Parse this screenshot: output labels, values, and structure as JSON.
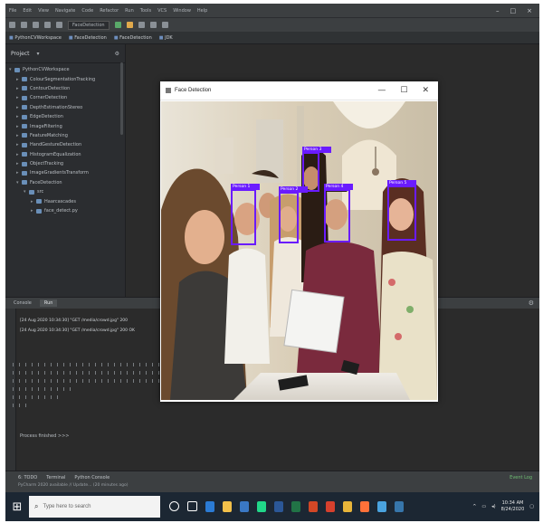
{
  "ide": {
    "menu": [
      "File",
      "Edit",
      "View",
      "Navigate",
      "Code",
      "Refactor",
      "Run",
      "Tools",
      "VCS",
      "Window",
      "Help"
    ],
    "toolbar": {
      "config_combo": "FaceDetection"
    },
    "breadcrumbs": [
      "PythonCVWorkspace",
      "FaceDetection",
      "FaceDetection",
      "JDK"
    ],
    "sidebar": {
      "title": "Project",
      "items": [
        {
          "label": "PythonCVWorkspace",
          "open": true,
          "selected": false
        },
        {
          "label": "ColourSegmentationTracking",
          "open": false
        },
        {
          "label": "ContourDetection",
          "open": false
        },
        {
          "label": "CornerDetection",
          "open": false
        },
        {
          "label": "DepthEstimationStereo",
          "open": false
        },
        {
          "label": "EdgeDetection",
          "open": false
        },
        {
          "label": "ImageFiltering",
          "open": false
        },
        {
          "label": "FeatureMatching",
          "open": false
        },
        {
          "label": "HandGestureDetection",
          "open": false
        },
        {
          "label": "HistogramEqualization",
          "open": false
        },
        {
          "label": "ObjectTracking",
          "open": false
        },
        {
          "label": "ImageGradientsTransform",
          "open": false
        },
        {
          "label": "FaceDetection",
          "open": true
        },
        {
          "label": "src",
          "open": true
        },
        {
          "label": "Haarcascades",
          "open": false
        },
        {
          "label": "face_detect.py",
          "open": false
        }
      ]
    },
    "console": {
      "tabs": [
        "Console",
        "Run"
      ],
      "lines": [
        "[24 Aug 2020 10:34:30] \"GET /media/crowd.jpg\" 200",
        "[24 Aug 2020 10:34:30] \"GET /media/crowd.jpg\" 200 OK"
      ],
      "prompt": "Process finished >>>"
    },
    "status": {
      "tabs": [
        "6: TODO",
        "Terminal",
        "Python Console"
      ],
      "right": "Event Log",
      "message": "PyCharm 2020 available // Update... (20 minutes ago)"
    }
  },
  "cv_window": {
    "title": "Face Detection",
    "controls": [
      "—",
      "☐",
      "✕"
    ],
    "faces": [
      {
        "label": "Person 1"
      },
      {
        "label": "Person 2"
      },
      {
        "label": "Person 3"
      },
      {
        "label": "Person 4"
      },
      {
        "label": "Person 5"
      }
    ]
  },
  "taskbar": {
    "search_placeholder": "Type here to search",
    "time": "10:34 AM",
    "date": "8/24/2020",
    "icons": [
      "cortana-icon",
      "task-view-icon",
      "edge-icon",
      "file-explorer-icon",
      "store-icon",
      "pycharm-icon",
      "word-icon",
      "excel-icon",
      "powerpoint-icon",
      "acrobat-icon",
      "chrome-icon",
      "firefox-icon",
      "notepad-icon",
      "python-icon"
    ]
  },
  "colors": {
    "facebox": "#6a1bff",
    "ide_bg": "#2b2d30",
    "taskbar": "#1c2733"
  }
}
